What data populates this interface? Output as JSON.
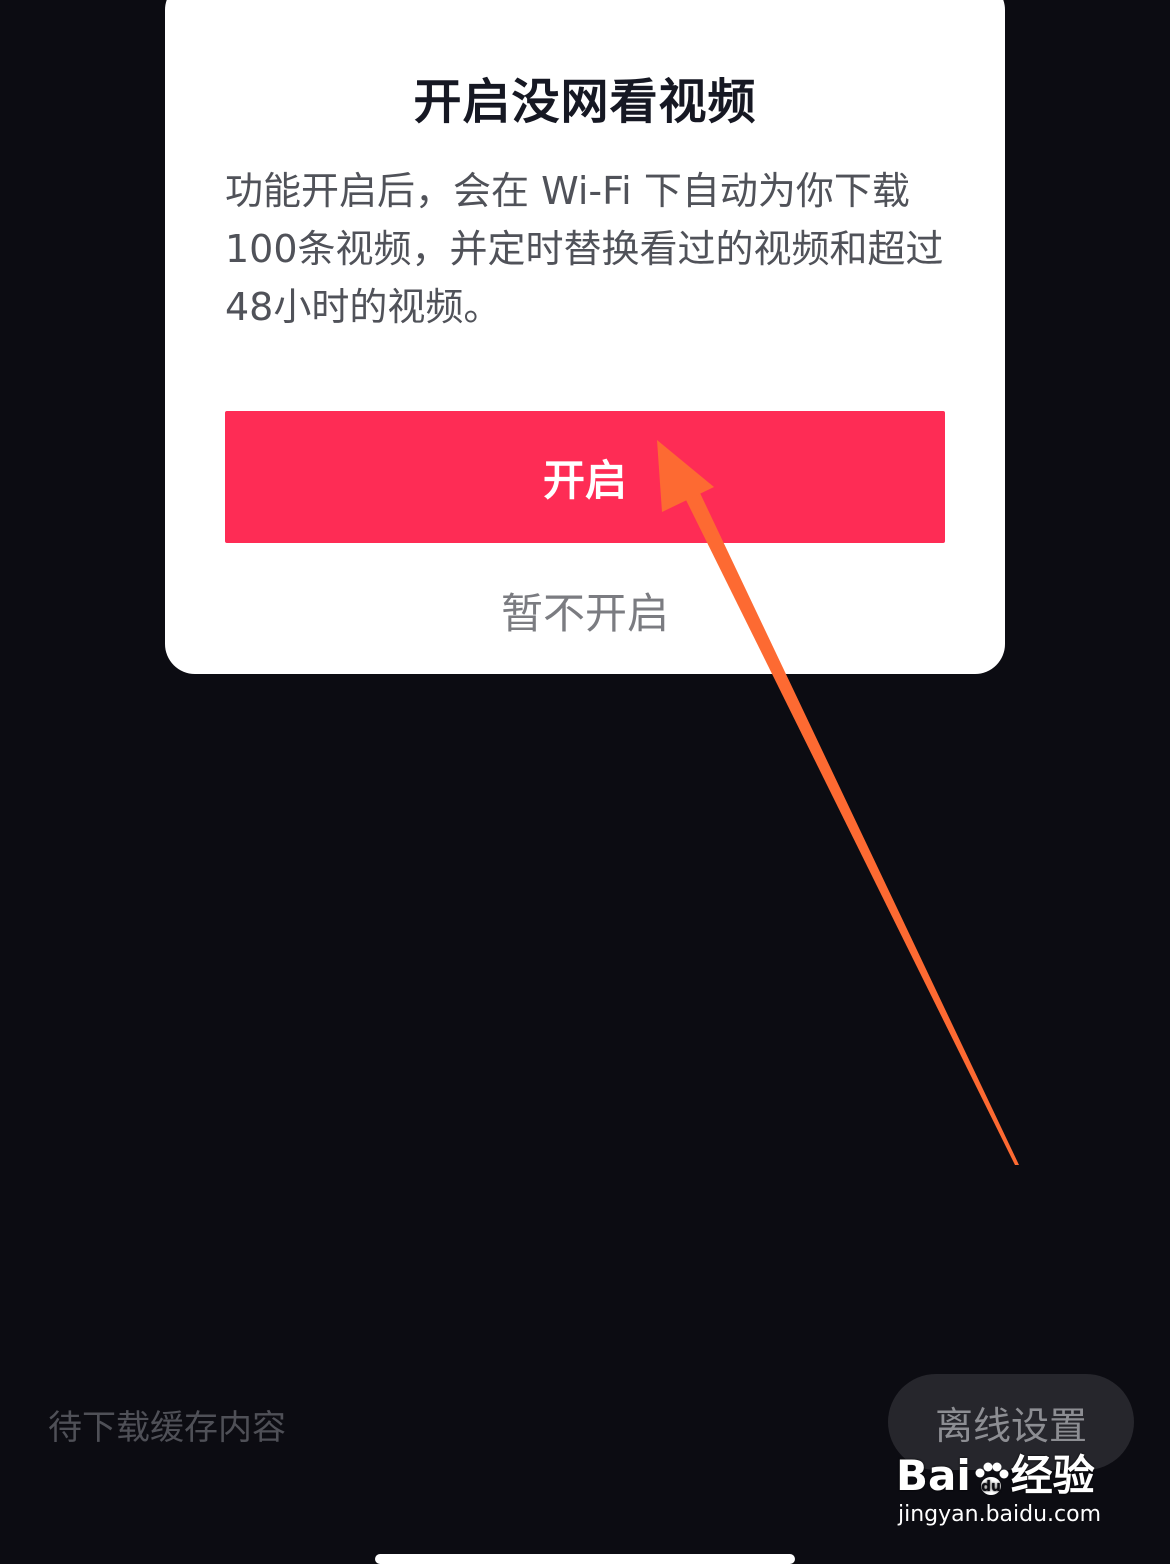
{
  "dialog": {
    "title": "开启没网看视频",
    "body": "功能开启后，会在 Wi-Fi 下自动为你下载100条视频，并定时替换看过的视频和超过48小时的视频。",
    "confirm_label": "开启",
    "decline_label": "暂不开启"
  },
  "page": {
    "pending_label": "待下载缓存内容",
    "offline_settings_label": "离线设置"
  },
  "watermark": {
    "logo_text_left": "Bai",
    "logo_text_right": "经验",
    "url": "jingyan.baidu.com"
  },
  "colors": {
    "primary": "#fe2c55",
    "arrow": "#fd6a32",
    "background": "#0c0c12"
  }
}
